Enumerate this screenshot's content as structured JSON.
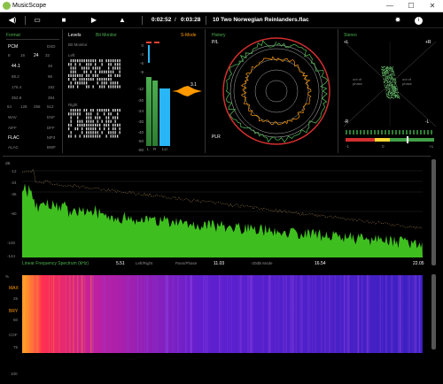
{
  "window": {
    "title": "MusicScope",
    "controls": [
      "—",
      "☐",
      "✕"
    ]
  },
  "toolbar": {
    "position": "0:02:52",
    "separator": "/",
    "duration": "0:03:28",
    "track": "10 Two Norwegian Reinlanders.flac"
  },
  "format": {
    "title": "Format",
    "pcm": "PCM",
    "dsd": "DSD",
    "bits": [
      "8",
      "16",
      "24",
      "32"
    ],
    "rates_left": [
      "44.1",
      "88.2",
      "176.4",
      "352.8"
    ],
    "rates_right": [
      "48",
      "96",
      "192",
      "384"
    ],
    "dsd_rates": [
      "64",
      "128",
      "256",
      "512"
    ],
    "formats_left": [
      "WAV",
      "AIFF",
      "FLAC",
      "ALAC"
    ],
    "formats_right": [
      "DSF",
      "DFF",
      "MP3",
      "BWF"
    ]
  },
  "levels": {
    "title": "Levels",
    "bit_monitor": "Bit Monitor",
    "bit_monitor_sub": "Bit Monitor",
    "left": "Left",
    "right": "Right",
    "scale": [
      "0",
      "-3",
      "-6",
      "-9",
      "-12",
      "-20",
      "-24",
      "-30",
      "-40",
      "-50",
      "-60"
    ],
    "meter_labels": [
      "L",
      "R",
      "LU"
    ],
    "s_mode": "S-Mode",
    "loudness_value": "3.1"
  },
  "history": {
    "title": "History",
    "pl": "P/L",
    "plr": "PLR"
  },
  "stereo": {
    "title": "Stereo",
    "plus_l": "+L",
    "plus_r": "+R",
    "minus_l": "-L",
    "minus_r": "-R",
    "out_of_phase_l": "out of phase",
    "out_of_phase_r": "out of phase",
    "corr_scale": [
      "-1",
      "0",
      "+1"
    ]
  },
  "spectrum": {
    "title": "Linear Frequency Spectrum (kHz)",
    "db_label": "dB",
    "y_ticks": [
      "-12",
      "-24",
      "-36",
      "-60",
      "-100",
      "-144"
    ],
    "x_ticks": [
      "5.51",
      "11.03",
      "16.54",
      "22.05"
    ],
    "modes": [
      "Left/Right",
      "Pans/Phase",
      "-20dB Mode"
    ]
  },
  "spectrogram": {
    "y_label": "%",
    "y_ticks": [
      "25",
      "50",
      "75",
      "100"
    ],
    "markers": [
      "MAX",
      "BRY",
      "COF"
    ]
  },
  "colors": {
    "accent": "#4caf50",
    "orange": "#ff9800",
    "red": "#f44336",
    "blue": "#29b6f6"
  }
}
